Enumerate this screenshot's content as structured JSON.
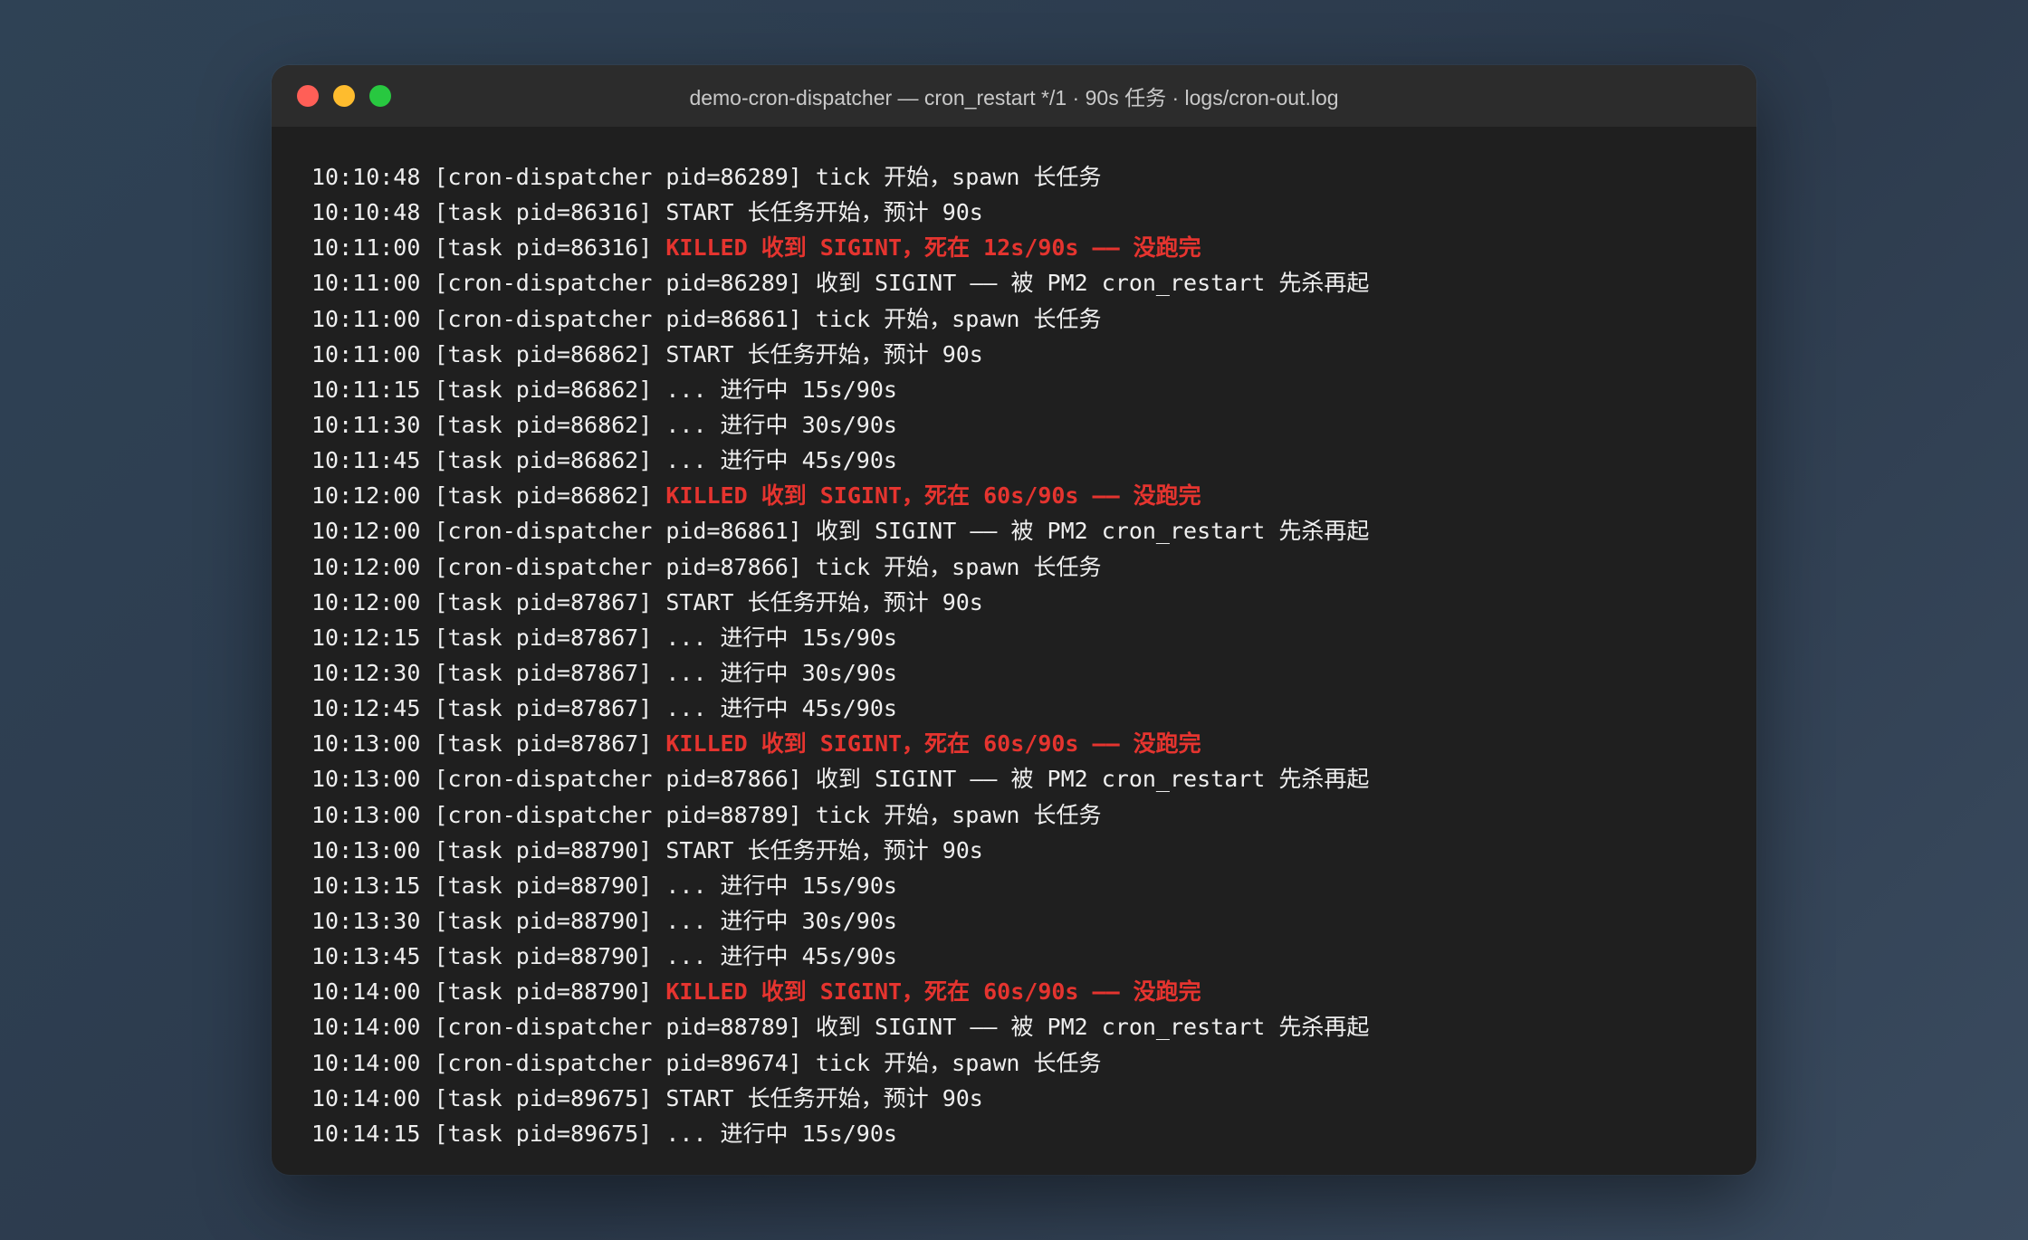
{
  "window": {
    "title": "demo-cron-dispatcher — cron_restart */1 · 90s 任务 · logs/cron-out.log"
  },
  "colors": {
    "killed": "#e5342f",
    "text": "#efefef",
    "terminal_bg": "#1f1f1f",
    "titlebar_bg": "#2c2c2c",
    "close": "#ff5f57",
    "minimize": "#febc2e",
    "maximize": "#28c840"
  },
  "log": {
    "lines": [
      {
        "prefix": "10:10:48 [cron-dispatcher pid=86289] ",
        "message": "tick 开始，spawn 长任务",
        "killed": ""
      },
      {
        "prefix": "10:10:48 [task pid=86316] ",
        "message": "START 长任务开始，预计 90s",
        "killed": ""
      },
      {
        "prefix": "10:11:00 [task pid=86316] ",
        "message": "",
        "killed": "KILLED 收到 SIGINT，死在 12s/90s —— 没跑完"
      },
      {
        "prefix": "10:11:00 [cron-dispatcher pid=86289] ",
        "message": "收到 SIGINT —— 被 PM2 cron_restart 先杀再起",
        "killed": ""
      },
      {
        "prefix": "10:11:00 [cron-dispatcher pid=86861] ",
        "message": "tick 开始，spawn 长任务",
        "killed": ""
      },
      {
        "prefix": "10:11:00 [task pid=86862] ",
        "message": "START 长任务开始，预计 90s",
        "killed": ""
      },
      {
        "prefix": "10:11:15 [task pid=86862] ",
        "message": "... 进行中 15s/90s",
        "killed": ""
      },
      {
        "prefix": "10:11:30 [task pid=86862] ",
        "message": "... 进行中 30s/90s",
        "killed": ""
      },
      {
        "prefix": "10:11:45 [task pid=86862] ",
        "message": "... 进行中 45s/90s",
        "killed": ""
      },
      {
        "prefix": "10:12:00 [task pid=86862] ",
        "message": "",
        "killed": "KILLED 收到 SIGINT，死在 60s/90s —— 没跑完"
      },
      {
        "prefix": "10:12:00 [cron-dispatcher pid=86861] ",
        "message": "收到 SIGINT —— 被 PM2 cron_restart 先杀再起",
        "killed": ""
      },
      {
        "prefix": "10:12:00 [cron-dispatcher pid=87866] ",
        "message": "tick 开始，spawn 长任务",
        "killed": ""
      },
      {
        "prefix": "10:12:00 [task pid=87867] ",
        "message": "START 长任务开始，预计 90s",
        "killed": ""
      },
      {
        "prefix": "10:12:15 [task pid=87867] ",
        "message": "... 进行中 15s/90s",
        "killed": ""
      },
      {
        "prefix": "10:12:30 [task pid=87867] ",
        "message": "... 进行中 30s/90s",
        "killed": ""
      },
      {
        "prefix": "10:12:45 [task pid=87867] ",
        "message": "... 进行中 45s/90s",
        "killed": ""
      },
      {
        "prefix": "10:13:00 [task pid=87867] ",
        "message": "",
        "killed": "KILLED 收到 SIGINT，死在 60s/90s —— 没跑完"
      },
      {
        "prefix": "10:13:00 [cron-dispatcher pid=87866] ",
        "message": "收到 SIGINT —— 被 PM2 cron_restart 先杀再起",
        "killed": ""
      },
      {
        "prefix": "10:13:00 [cron-dispatcher pid=88789] ",
        "message": "tick 开始，spawn 长任务",
        "killed": ""
      },
      {
        "prefix": "10:13:00 [task pid=88790] ",
        "message": "START 长任务开始，预计 90s",
        "killed": ""
      },
      {
        "prefix": "10:13:15 [task pid=88790] ",
        "message": "... 进行中 15s/90s",
        "killed": ""
      },
      {
        "prefix": "10:13:30 [task pid=88790] ",
        "message": "... 进行中 30s/90s",
        "killed": ""
      },
      {
        "prefix": "10:13:45 [task pid=88790] ",
        "message": "... 进行中 45s/90s",
        "killed": ""
      },
      {
        "prefix": "10:14:00 [task pid=88790] ",
        "message": "",
        "killed": "KILLED 收到 SIGINT，死在 60s/90s —— 没跑完"
      },
      {
        "prefix": "10:14:00 [cron-dispatcher pid=88789] ",
        "message": "收到 SIGINT —— 被 PM2 cron_restart 先杀再起",
        "killed": ""
      },
      {
        "prefix": "10:14:00 [cron-dispatcher pid=89674] ",
        "message": "tick 开始，spawn 长任务",
        "killed": ""
      },
      {
        "prefix": "10:14:00 [task pid=89675] ",
        "message": "START 长任务开始，预计 90s",
        "killed": ""
      },
      {
        "prefix": "10:14:15 [task pid=89675] ",
        "message": "... 进行中 15s/90s",
        "killed": ""
      }
    ]
  }
}
